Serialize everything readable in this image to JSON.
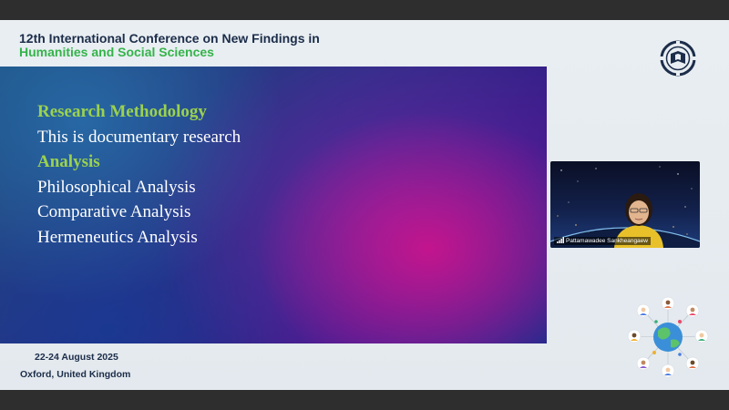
{
  "header": {
    "title_line1": "12th International Conference on New Findings in",
    "title_line2": "Humanities and Social Sciences"
  },
  "slide": {
    "lines": [
      {
        "text": "Research Methodology",
        "style": "heading"
      },
      {
        "text": "This is documentary research",
        "style": "body"
      },
      {
        "text": "Analysis",
        "style": "heading"
      },
      {
        "text": "Philosophical Analysis",
        "style": "body"
      },
      {
        "text": "Comparative Analysis",
        "style": "body"
      },
      {
        "text": "Hermeneutics Analysis",
        "style": "body"
      }
    ]
  },
  "video": {
    "participant_name": "Pattamawadee Sankheangaew",
    "icon": "signal-bars-icon"
  },
  "footer": {
    "date": "22-24 August 2025",
    "location": "Oxford, United Kingdom"
  },
  "colors": {
    "title_dark": "#1c2d4a",
    "title_green": "#35b34a",
    "slide_heading": "#9bd24e",
    "slide_text": "#ffffff"
  }
}
